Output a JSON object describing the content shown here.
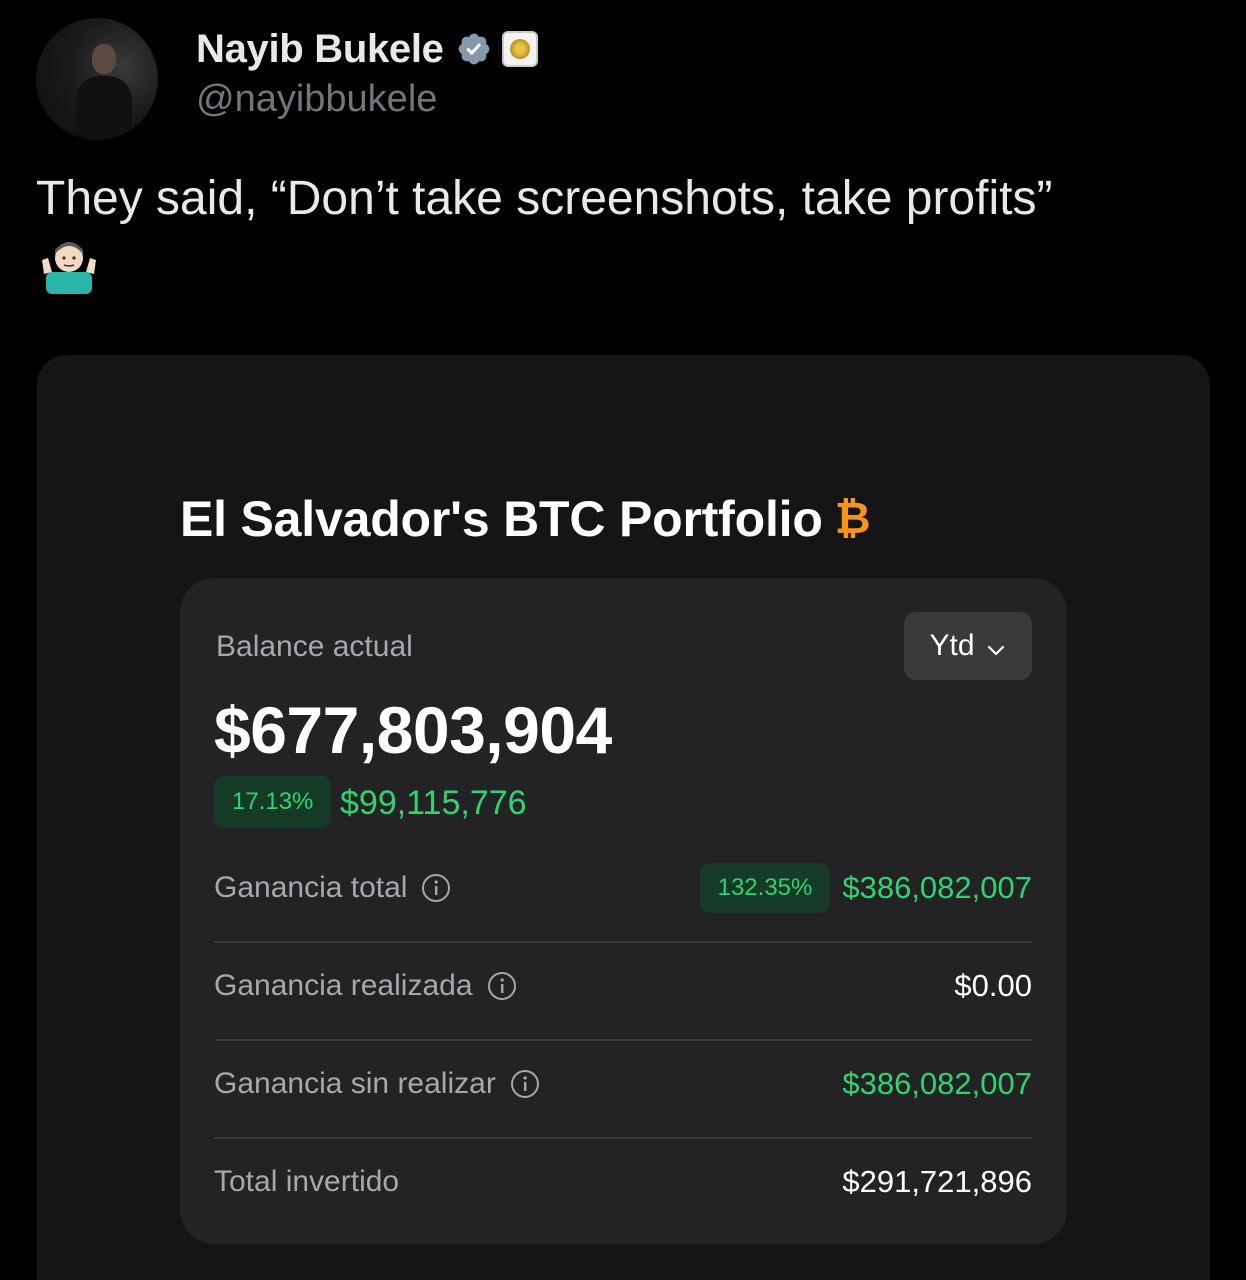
{
  "tweet": {
    "author_name": "Nayib Bukele",
    "author_handle": "@nayibbukele",
    "text": "They said, “Don’t take screenshots, take profits”",
    "emoji": "shrug-emoji"
  },
  "portfolio": {
    "title": "El Salvador's BTC Portfolio",
    "title_icon": "₿",
    "balance_label": "Balance actual",
    "period": "Ytd",
    "balance": "$677,803,904",
    "change_percent": "17.13%",
    "change_amount": "$99,115,776",
    "rows": [
      {
        "label": "Ganancia total",
        "badge": "132.35%",
        "value": "$386,082,007"
      },
      {
        "label": "Ganancia realizada",
        "value": "$0.00"
      },
      {
        "label": "Ganancia sin realizar",
        "value": "$386,082,007"
      },
      {
        "label": "Total invertido",
        "value": "$291,721,896"
      }
    ]
  },
  "colors": {
    "background": "#000000",
    "panel": "#232325",
    "positive": "#2fd46f",
    "bitcoin": "#f7931a",
    "verified": "#829aab"
  }
}
